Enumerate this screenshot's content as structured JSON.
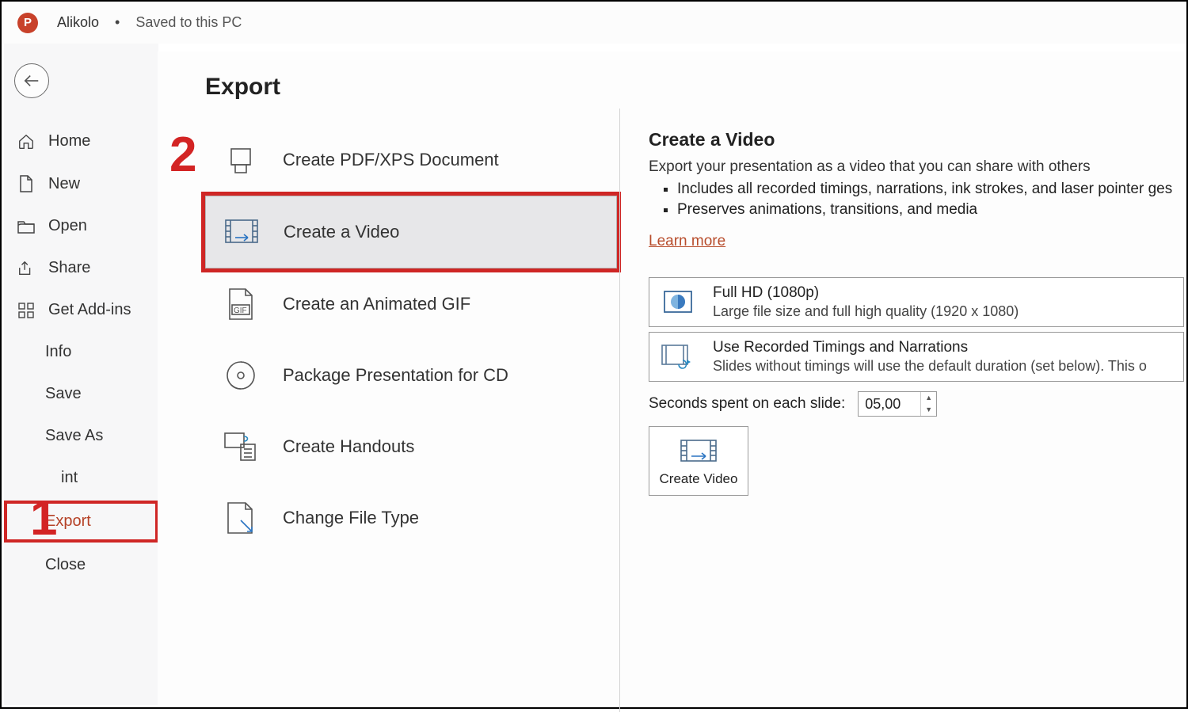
{
  "titlebar": {
    "doc_name": "Alikolo",
    "separator": "•",
    "status": "Saved to this PC"
  },
  "nav": {
    "back_label": "Back",
    "items": [
      {
        "label": "Home"
      },
      {
        "label": "New"
      },
      {
        "label": "Open"
      },
      {
        "label": "Share"
      },
      {
        "label": "Get Add-ins"
      },
      {
        "label": "Info"
      },
      {
        "label": "Save"
      },
      {
        "label": "Save As"
      },
      {
        "label": "int"
      },
      {
        "label": "Export"
      },
      {
        "label": "Close"
      }
    ]
  },
  "main": {
    "title": "Export",
    "options": [
      {
        "label": "Create PDF/XPS Document"
      },
      {
        "label": "Create a Video"
      },
      {
        "label": "Create an Animated GIF"
      },
      {
        "label": "Package Presentation for CD"
      },
      {
        "label": "Create Handouts"
      },
      {
        "label": "Change File Type"
      }
    ]
  },
  "detail": {
    "heading": "Create a Video",
    "sub": "Export your presentation as a video that you can share with others",
    "bullets": [
      "Includes all recorded timings, narrations, ink strokes, and laser pointer ges",
      "Preserves animations, transitions, and media"
    ],
    "learn_more": "Learn more",
    "quality": {
      "title": "Full HD (1080p)",
      "desc": "Large file size and full high quality (1920 x 1080)"
    },
    "timings": {
      "title": "Use Recorded Timings and Narrations",
      "desc": "Slides without timings will use the default duration (set below). This o"
    },
    "seconds_label": "Seconds spent on each slide:",
    "seconds_value": "05,00",
    "create_button": "Create Video"
  },
  "annotations": {
    "one": "1",
    "two": "2"
  }
}
